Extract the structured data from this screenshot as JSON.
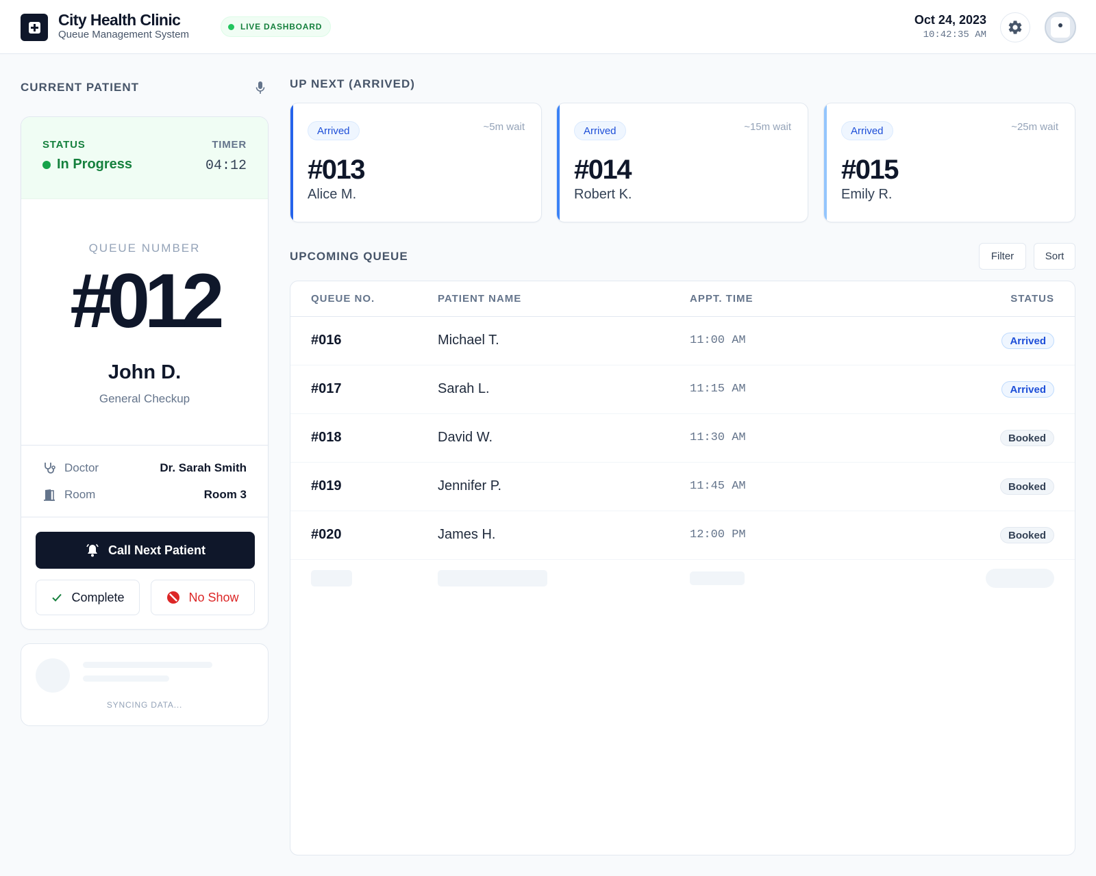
{
  "header": {
    "clinic_name": "City Health Clinic",
    "clinic_subtitle": "Queue Management System",
    "live_badge": "LIVE DASHBOARD",
    "date": "Oct 24, 2023",
    "time": "10:42:35 AM"
  },
  "current_patient": {
    "section_label": "CURRENT PATIENT",
    "status_label": "STATUS",
    "status_value": "In Progress",
    "timer_label": "TIMER",
    "timer_value": "04:12",
    "queue_label": "QUEUE NUMBER",
    "queue_number": "#012",
    "name": "John D.",
    "visit_type": "General Checkup",
    "doctor_label": "Doctor",
    "doctor_value": "Dr. Sarah Smith",
    "room_label": "Room",
    "room_value": "Room 3",
    "call_next_label": "Call Next Patient",
    "complete_label": "Complete",
    "no_show_label": "No Show"
  },
  "sync": {
    "text": "SYNCING DATA..."
  },
  "up_next": {
    "section_label": "UP NEXT (ARRIVED)",
    "cards": [
      {
        "status": "Arrived",
        "wait": "~5m wait",
        "number": "#013",
        "name": "Alice M."
      },
      {
        "status": "Arrived",
        "wait": "~15m wait",
        "number": "#014",
        "name": "Robert K."
      },
      {
        "status": "Arrived",
        "wait": "~25m wait",
        "number": "#015",
        "name": "Emily R."
      }
    ]
  },
  "upcoming_queue": {
    "section_label": "UPCOMING QUEUE",
    "filter_label": "Filter",
    "sort_label": "Sort",
    "columns": [
      "QUEUE NO.",
      "PATIENT NAME",
      "APPT. TIME",
      "STATUS"
    ],
    "rows": [
      {
        "number": "#016",
        "name": "Michael T.",
        "time": "11:00 AM",
        "status": "Arrived"
      },
      {
        "number": "#017",
        "name": "Sarah L.",
        "time": "11:15 AM",
        "status": "Arrived"
      },
      {
        "number": "#018",
        "name": "David W.",
        "time": "11:30 AM",
        "status": "Booked"
      },
      {
        "number": "#019",
        "name": "Jennifer P.",
        "time": "11:45 AM",
        "status": "Booked"
      },
      {
        "number": "#020",
        "name": "James H.",
        "time": "12:00 PM",
        "status": "Booked"
      }
    ]
  },
  "icons": {
    "logo": "medical-plus-icon",
    "settings": "gear-icon",
    "mic": "microphone-icon",
    "doctor": "stethoscope-icon",
    "room": "door-icon",
    "call": "bell-icon",
    "complete": "check-icon",
    "no_show": "ban-icon"
  },
  "colors": {
    "primary": "#0f172a",
    "success": "#15803d",
    "danger": "#dc2626",
    "arrived": "#1d4ed8",
    "accent_blue": [
      "#2563eb",
      "#3b82f6",
      "#93c5fd"
    ]
  }
}
